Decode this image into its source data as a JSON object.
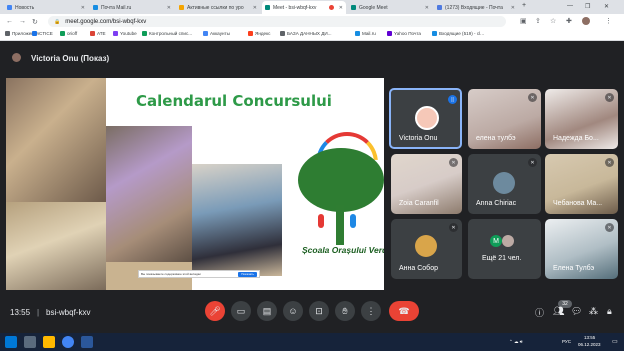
{
  "browser": {
    "tabs": [
      {
        "label": "Новость",
        "color": "#4285f4"
      },
      {
        "label": "Почта Mail.ru",
        "color": "#168de2"
      },
      {
        "label": "Активные ссылки по уро",
        "color": "#f4a400"
      },
      {
        "label": "Meet - bsi-wbqf-kxv",
        "color": "#00897b",
        "active": true
      },
      {
        "label": "Google Meet",
        "color": "#00897b"
      },
      {
        "label": "(1273) Входящие - Почта",
        "color": "#4f7ae0"
      }
    ],
    "new_tab": "+",
    "url": "meet.google.com/bsi-wbqf-kxv",
    "bookmarks": [
      "Приложения",
      "CTICE",
      "orioff",
      "ATE",
      "Youtube",
      "Контрольный спис...",
      "Аккаунты",
      "Яндекс",
      "БАЗА ДАННЫХ ДИ...",
      "Mail.ru",
      "Yahoo Почта",
      "Входящие (519) - cl..."
    ]
  },
  "meet": {
    "presenter": "Victoria Onu (Показ)",
    "slide": {
      "title": "Calendarul Concursului",
      "school": "Școala Orașului Verde",
      "share_notice": "Вы показываете содержимое этой вкладки",
      "share_button": "Показать"
    },
    "participants": [
      {
        "name": "Victoria Onu",
        "speaking": true,
        "avatar_color": "#f6c8b8"
      },
      {
        "name": "елена тулбэ",
        "avatar_color": "#bcaaa4"
      },
      {
        "name": "Надежда Бо...",
        "avatar_color": "#a1887f"
      },
      {
        "name": "Zoia Caranfil",
        "avatar_color": "#d7ccc8"
      },
      {
        "name": "Anna Chiriac",
        "avatar_color": "#6d8a9e"
      },
      {
        "name": "Чебанова Ма...",
        "avatar_color": "#c8b89a"
      },
      {
        "name": "Анна Собор",
        "avatar_color": "#d9a54a"
      },
      {
        "name": "Ещё 21 чел.",
        "initial": "М"
      },
      {
        "name": "Елена Тулбэ",
        "avatar_color": "#b0bec5"
      }
    ],
    "time": "13:55",
    "separator": "|",
    "code": "bsi-wbqf-kxv",
    "people_count": "32",
    "icons": {
      "mic": "mic-off-icon",
      "camera": "camera-icon",
      "captions": "captions-icon",
      "emoji": "emoji-icon",
      "present": "present-icon",
      "hand": "raise-hand-icon",
      "more": "more-icon",
      "hangup": "hangup-icon"
    }
  },
  "taskbar": {
    "language": "РУС",
    "time": "13:55",
    "date": "06.12.2023"
  },
  "colors": {
    "meet_bg": "#202124",
    "tile_bg": "#3c4043",
    "hangup": "#ea4335",
    "mic_off": "#ea4335",
    "slide_title": "#2e9a48"
  }
}
